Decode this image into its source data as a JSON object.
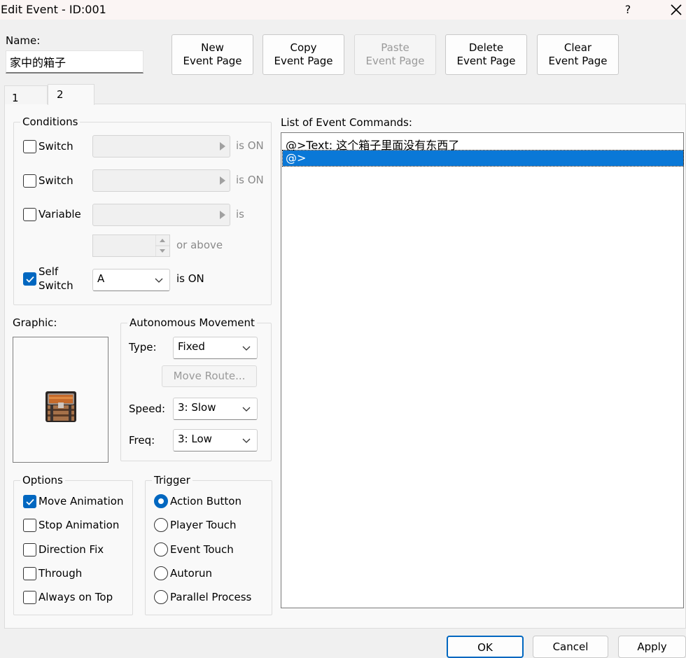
{
  "window": {
    "title": "Edit Event - ID:001",
    "help": "?"
  },
  "name_field": {
    "label": "Name:",
    "value": "家中的箱子"
  },
  "toolbar": {
    "new_page": [
      "New",
      "Event Page"
    ],
    "copy_page": [
      "Copy",
      "Event Page"
    ],
    "paste_page": [
      "Paste",
      "Event Page"
    ],
    "delete_page": [
      "Delete",
      "Event Page"
    ],
    "clear_page": [
      "Clear",
      "Event Page"
    ]
  },
  "tabs": [
    "1",
    "2"
  ],
  "conditions": {
    "title": "Conditions",
    "switch1": {
      "label": "Switch",
      "suffix": "is ON",
      "checked": false
    },
    "switch2": {
      "label": "Switch",
      "suffix": "is ON",
      "checked": false
    },
    "variable": {
      "label": "Variable",
      "suffix": "is",
      "or_above": "or above",
      "checked": false
    },
    "self_switch": {
      "label_line1": "Self",
      "label_line2": "Switch",
      "value": "A",
      "suffix": "is ON",
      "checked": true
    }
  },
  "graphic": {
    "label": "Graphic:",
    "icon": "treasure-chest-icon"
  },
  "autonomous_movement": {
    "title": "Autonomous Movement",
    "type_label": "Type:",
    "type_value": "Fixed",
    "move_route": "Move Route...",
    "speed_label": "Speed:",
    "speed_value": "3: Slow",
    "freq_label": "Freq:",
    "freq_value": "3: Low"
  },
  "options": {
    "title": "Options",
    "items": [
      {
        "label": "Move Animation",
        "checked": true
      },
      {
        "label": "Stop Animation",
        "checked": false
      },
      {
        "label": "Direction Fix",
        "checked": false
      },
      {
        "label": "Through",
        "checked": false
      },
      {
        "label": "Always on Top",
        "checked": false
      }
    ]
  },
  "trigger": {
    "title": "Trigger",
    "items": [
      {
        "label": "Action Button",
        "checked": true
      },
      {
        "label": "Player Touch",
        "checked": false
      },
      {
        "label": "Event Touch",
        "checked": false
      },
      {
        "label": "Autorun",
        "checked": false
      },
      {
        "label": "Parallel Process",
        "checked": false
      }
    ]
  },
  "event_commands": {
    "label": "List of Event Commands:",
    "rows": [
      "@>Text: 这个箱子里面没有东西了",
      "@>"
    ],
    "selected_index": 1
  },
  "footer": {
    "ok": "OK",
    "cancel": "Cancel",
    "apply": "Apply"
  },
  "colors": {
    "accent": "#0067c0",
    "selection": "#0a78d7"
  }
}
